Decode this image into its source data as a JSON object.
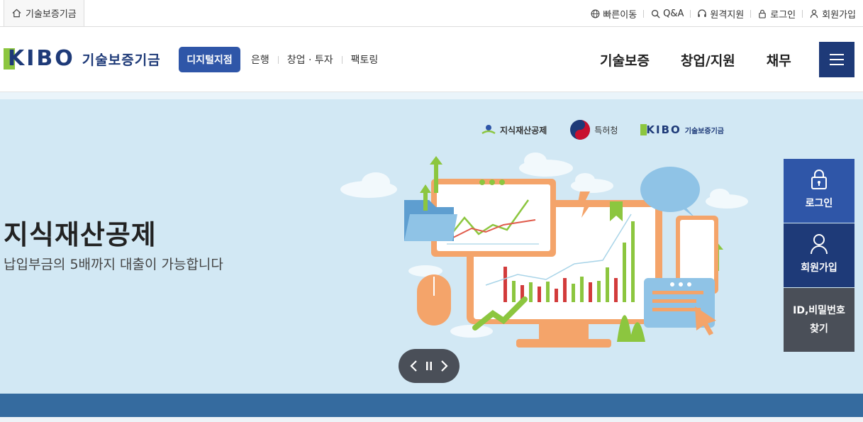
{
  "util": {
    "home_label": "기술보증기금",
    "links": [
      "빠른이동",
      "Q&A",
      "원격지원",
      "로그인",
      "회원가입"
    ]
  },
  "header": {
    "logo_text": "KIBO",
    "logo_name": "기술보증기금",
    "digital_label": "디지털지점",
    "sub_links": [
      "은행",
      "창업 · 투자",
      "팩토링"
    ],
    "gnb": [
      "기술보증",
      "창업/지원",
      "채무"
    ]
  },
  "hero": {
    "partners": [
      "지식재산공제",
      "특허청",
      "기술보증기금"
    ],
    "title": "지식재산공제",
    "subtitle": "납입부금의 5배까지 대출이 가능합니다"
  },
  "quick": {
    "login": "로그인",
    "join": "회원가입",
    "find_line1": "ID,비밀번호",
    "find_line2": "찾기"
  },
  "colors": {
    "brand_navy": "#1e3a78",
    "brand_blue": "#2f56a8",
    "brand_green": "#8cc63f",
    "hero_bg": "#d2e8f4",
    "band": "#356b9f",
    "gray_panel": "#4a4f58"
  },
  "icons": {
    "home": "home-icon",
    "quick_move": "globe-icon",
    "qa": "search-icon",
    "remote": "headset-icon",
    "login": "lock-icon",
    "join": "user-icon",
    "menu": "hamburger-icon"
  }
}
